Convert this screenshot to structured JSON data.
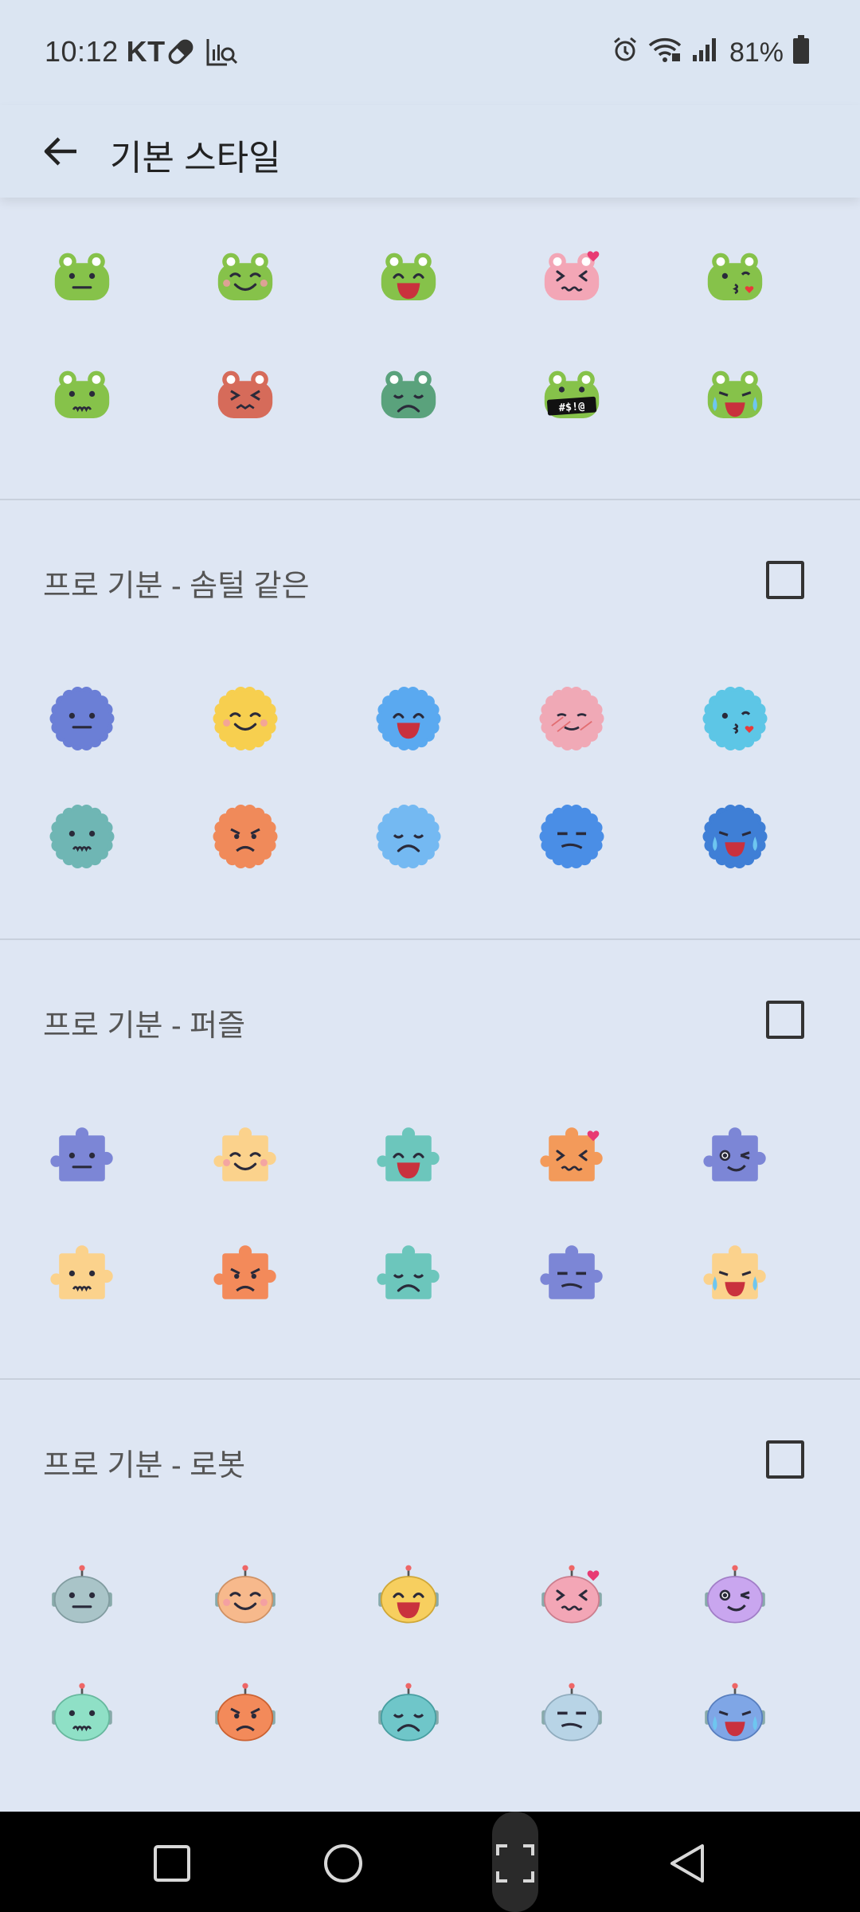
{
  "status_bar": {
    "time": "10:12",
    "carrier": "KT",
    "battery": "81%",
    "icons": [
      "pill-icon",
      "chart-search-icon",
      "alarm-icon",
      "wifi-icon",
      "signal-icon",
      "battery-icon"
    ]
  },
  "app_bar": {
    "title": "기본 스타일",
    "back_icon": "arrow-left-icon"
  },
  "sections": [
    {
      "id": "frog",
      "title": "",
      "checked": false,
      "stickers": [
        {
          "shape": "frog",
          "color": "#86c24a",
          "face": "neutral"
        },
        {
          "shape": "frog",
          "color": "#86c24a",
          "face": "smile"
        },
        {
          "shape": "frog",
          "color": "#86c24a",
          "face": "laugh"
        },
        {
          "shape": "frog",
          "color": "#f3a6b6",
          "face": "love"
        },
        {
          "shape": "frog",
          "color": "#86c24a",
          "face": "kiss"
        },
        {
          "shape": "frog",
          "color": "#86c24a",
          "face": "worried"
        },
        {
          "shape": "frog",
          "color": "#d66b5a",
          "face": "sick"
        },
        {
          "shape": "frog",
          "color": "#5aa27c",
          "face": "sad"
        },
        {
          "shape": "frog",
          "color": "#86c24a",
          "face": "swear",
          "text": "#$!@"
        },
        {
          "shape": "frog",
          "color": "#86c24a",
          "face": "cry"
        }
      ]
    },
    {
      "id": "fluffy",
      "title": "프로 기분 - 솜털 같은",
      "checked": false,
      "stickers": [
        {
          "shape": "fluffy",
          "color": "#6b7fd6",
          "face": "neutral"
        },
        {
          "shape": "fluffy",
          "color": "#f7cf4f",
          "face": "smile"
        },
        {
          "shape": "fluffy",
          "color": "#5aa9f0",
          "face": "laugh"
        },
        {
          "shape": "fluffy",
          "color": "#f0a9b6",
          "face": "shy"
        },
        {
          "shape": "fluffy",
          "color": "#5dc6e6",
          "face": "kiss"
        },
        {
          "shape": "fluffy",
          "color": "#6fb6b4",
          "face": "worried"
        },
        {
          "shape": "fluffy",
          "color": "#f08a5a",
          "face": "angry"
        },
        {
          "shape": "fluffy",
          "color": "#74b9f2",
          "face": "sad"
        },
        {
          "shape": "fluffy",
          "color": "#4a8ee6",
          "face": "annoyed"
        },
        {
          "shape": "fluffy",
          "color": "#3f7fd6",
          "face": "cry"
        }
      ]
    },
    {
      "id": "puzzle",
      "title": "프로 기분 - 퍼즐",
      "checked": false,
      "stickers": [
        {
          "shape": "puzzle",
          "color": "#7c86d6",
          "face": "neutral"
        },
        {
          "shape": "puzzle",
          "color": "#fbd28c",
          "face": "smile"
        },
        {
          "shape": "puzzle",
          "color": "#6cc6bc",
          "face": "laugh"
        },
        {
          "shape": "puzzle",
          "color": "#f39a5a",
          "face": "love"
        },
        {
          "shape": "puzzle",
          "color": "#7c86d6",
          "face": "wink"
        },
        {
          "shape": "puzzle",
          "color": "#fbd28c",
          "face": "worried"
        },
        {
          "shape": "puzzle",
          "color": "#f38a5a",
          "face": "angry"
        },
        {
          "shape": "puzzle",
          "color": "#6cc6bc",
          "face": "sad"
        },
        {
          "shape": "puzzle",
          "color": "#7c86d6",
          "face": "annoyed"
        },
        {
          "shape": "puzzle",
          "color": "#fbd28c",
          "face": "cry"
        }
      ]
    },
    {
      "id": "robot",
      "title": "프로 기분 - 로봇",
      "checked": false,
      "stickers": [
        {
          "shape": "robot",
          "color": "#a9c4c8",
          "face": "neutral"
        },
        {
          "shape": "robot",
          "color": "#f7b98c",
          "face": "smile"
        },
        {
          "shape": "robot",
          "color": "#f7cf5f",
          "face": "laugh"
        },
        {
          "shape": "robot",
          "color": "#f3a6b6",
          "face": "love"
        },
        {
          "shape": "robot",
          "color": "#c9a6ef",
          "face": "wink"
        },
        {
          "shape": "robot",
          "color": "#8fe0c6",
          "face": "worried"
        },
        {
          "shape": "robot",
          "color": "#f38a5a",
          "face": "angry"
        },
        {
          "shape": "robot",
          "color": "#6fc6c9",
          "face": "sad"
        },
        {
          "shape": "robot",
          "color": "#b8d4e6",
          "face": "annoyed"
        },
        {
          "shape": "robot",
          "color": "#7fa6e6",
          "face": "cry"
        }
      ]
    }
  ],
  "nav_bar": {
    "buttons": [
      "recents-square-icon",
      "home-circle-icon",
      "capture-icon",
      "back-triangle-icon"
    ]
  }
}
